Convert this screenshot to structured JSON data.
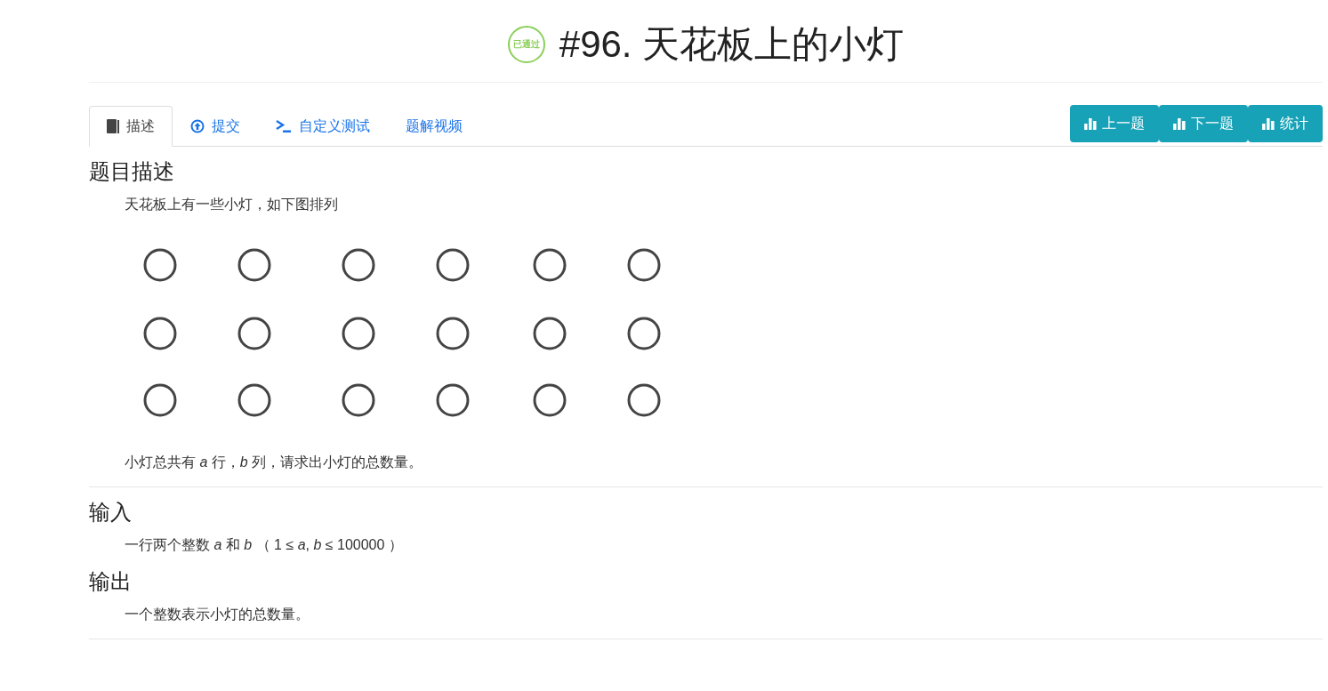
{
  "header": {
    "badge": "已通过",
    "title": "#96. 天花板上的小灯"
  },
  "tabs": [
    {
      "label": "描述",
      "kind": "book",
      "selected": true
    },
    {
      "label": "提交",
      "kind": "upload",
      "selected": false
    },
    {
      "label": "自定义测试",
      "kind": "terminal",
      "selected": false
    },
    {
      "label": "题解视频",
      "selected": false
    }
  ],
  "nav_buttons": [
    "上一题",
    "下一题",
    "统计"
  ],
  "sections": [
    {
      "heading": "题目描述",
      "divider_after": true,
      "blocks": [
        {
          "kind": "text",
          "text": "天花板上有一些小灯，如下图排列"
        },
        {
          "kind": "picture"
        },
        {
          "kind": "text",
          "text": "小灯总共有 *a* 行，*b* 列，请求出小灯的总数量。"
        }
      ]
    },
    {
      "heading": "输入",
      "divider_after": false,
      "blocks": [
        {
          "kind": "text",
          "text": "一行两个整数 *a* 和 *b* （ 1 ≤ *a*, *b* ≤ 100000 ）"
        }
      ]
    },
    {
      "heading": "输出",
      "divider_after": true,
      "blocks": [
        {
          "kind": "text",
          "text": "一个整数表示小灯的总数量。"
        }
      ]
    }
  ]
}
